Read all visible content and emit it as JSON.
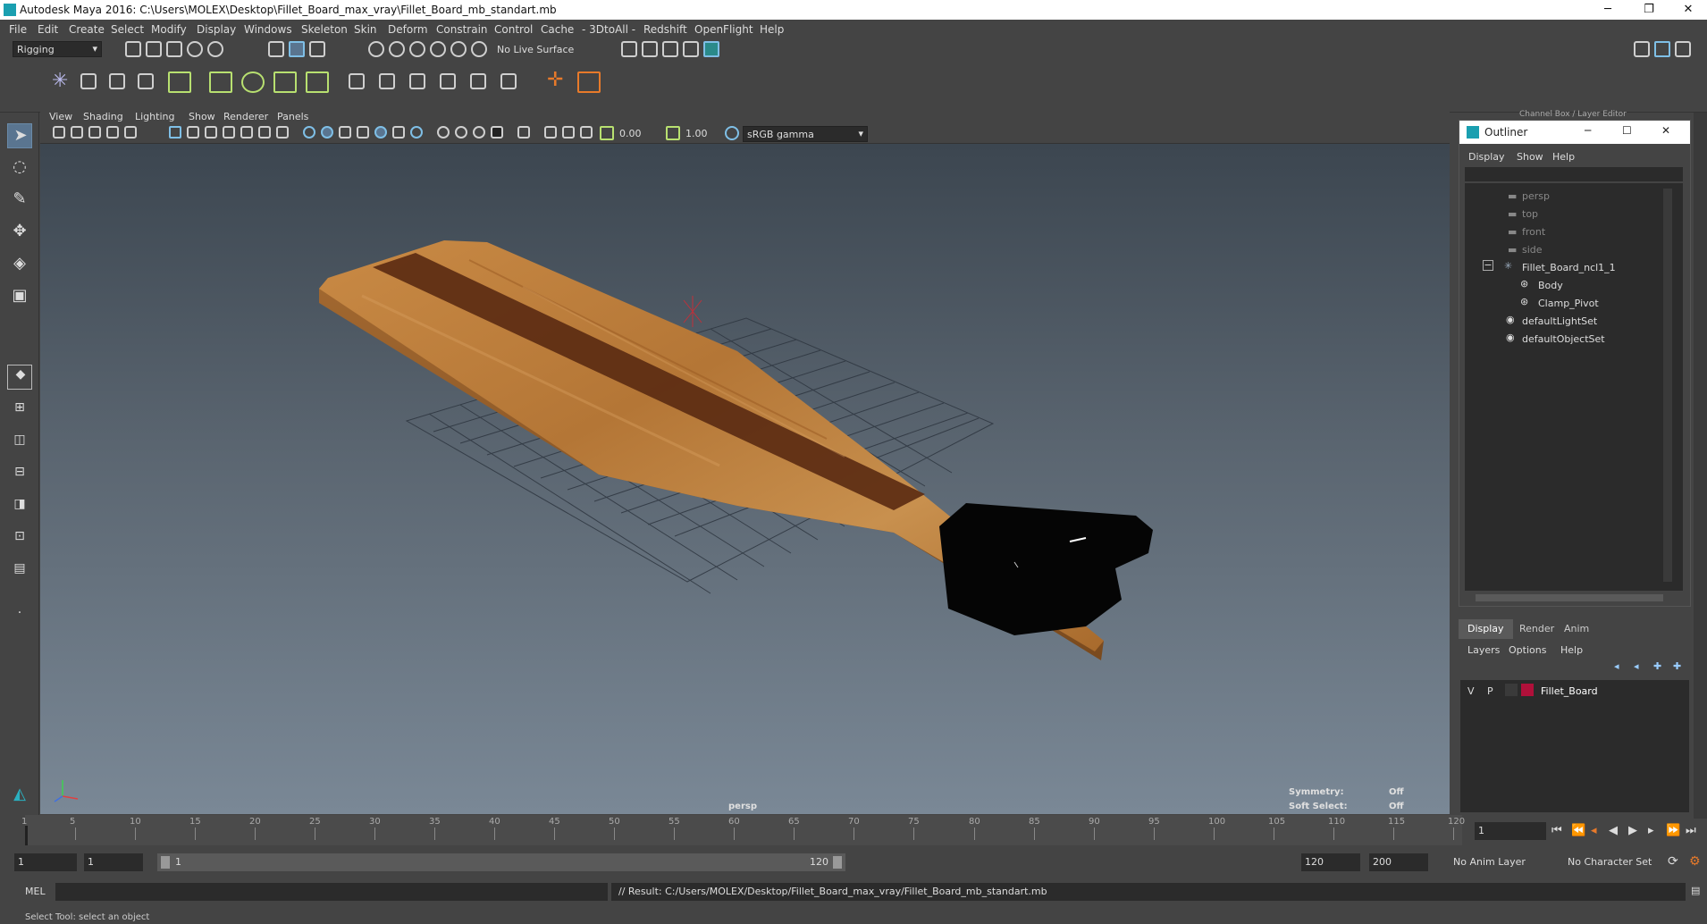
{
  "window": {
    "title": "Autodesk Maya 2016: C:\\Users\\MOLEX\\Desktop\\Fillet_Board_max_vray\\Fillet_Board_mb_standart.mb",
    "minimize": "─",
    "restore": "❐",
    "close": "✕"
  },
  "menubar": [
    "File",
    "Edit",
    "Create",
    "Select",
    "Modify",
    "Display",
    "Windows",
    "Skeleton",
    "Skin",
    "Deform",
    "Constrain",
    "Control",
    "Cache",
    "- 3DtoAll -",
    "Redshift",
    "OpenFlight",
    "Help"
  ],
  "statusline": {
    "menuset": "Rigging",
    "live_surface": "No Live Surface"
  },
  "panel_menu": [
    "View",
    "Shading",
    "Lighting",
    "Show",
    "Renderer",
    "Panels"
  ],
  "panel_toolbar": {
    "exposure": "0.00",
    "gamma": "1.00",
    "color_space": "sRGB gamma"
  },
  "viewport": {
    "camera_label": "persp",
    "symmetry_label": "Symmetry:",
    "symmetry_value": "Off",
    "soft_select_label": "Soft Select:",
    "soft_select_value": "Off"
  },
  "channel_box_title": "Channel Box / Layer Editor",
  "outliner": {
    "title": "Outliner",
    "menu": [
      "Display",
      "Show",
      "Help"
    ],
    "items": [
      {
        "label": "persp",
        "dim": true
      },
      {
        "label": "top",
        "dim": true
      },
      {
        "label": "front",
        "dim": true
      },
      {
        "label": "side",
        "dim": true
      },
      {
        "label": "Fillet_Board_ncl1_1",
        "dim": false
      },
      {
        "label": "Body",
        "dim": false
      },
      {
        "label": "Clamp_Pivot",
        "dim": false
      },
      {
        "label": "defaultLightSet",
        "dim": false
      },
      {
        "label": "defaultObjectSet",
        "dim": false
      }
    ]
  },
  "layer_editor": {
    "tabs": [
      "Display",
      "Render",
      "Anim"
    ],
    "menu": [
      "Layers",
      "Options",
      "Help"
    ],
    "layer": {
      "v": "V",
      "p": "P",
      "name": "Fillet_Board",
      "color": "#b0103a"
    }
  },
  "timeline": {
    "ticks": [
      1,
      5,
      10,
      15,
      20,
      25,
      30,
      35,
      40,
      45,
      50,
      55,
      60,
      65,
      70,
      75,
      80,
      85,
      90,
      95,
      100,
      105,
      110,
      115,
      120
    ],
    "current_frame": "1"
  },
  "range": {
    "start": "1",
    "playback_start": "1",
    "slider_start": "1",
    "slider_end": "120",
    "playback_end": "120",
    "end": "200",
    "anim_layer": "No Anim Layer",
    "character_set": "No Character Set"
  },
  "command": {
    "language": "MEL",
    "result": "// Result: C:/Users/MOLEX/Desktop/Fillet_Board_max_vray/Fillet_Board_mb_standart.mb"
  },
  "help_line": "Select Tool: select an object",
  "colors": {
    "accent": "#5a7590",
    "wood": "#b07a3a",
    "wood_stripe": "#5a2a12",
    "layer_color": "#b0103a"
  }
}
